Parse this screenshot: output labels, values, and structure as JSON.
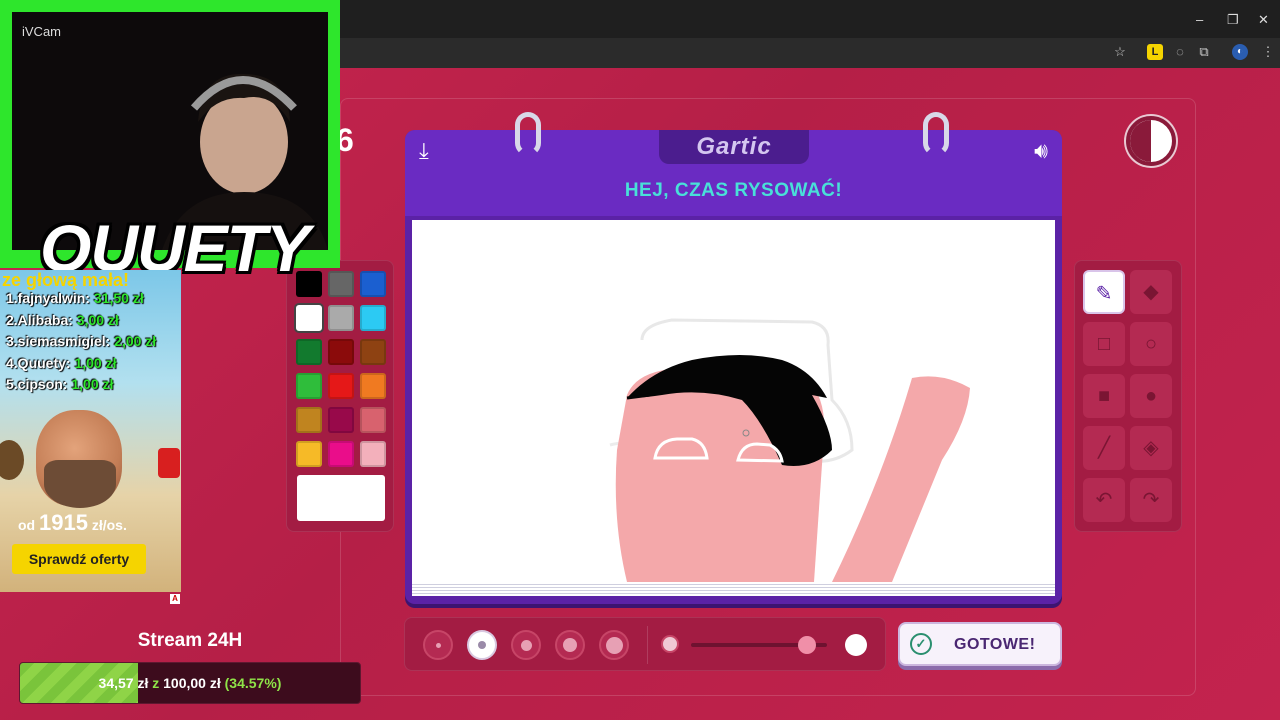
{
  "window": {
    "minimize": "–",
    "maximize": "❐",
    "close": "✕"
  },
  "game": {
    "round_digit": "6",
    "logo": "Gartic",
    "message": "HEJ, CZAS RYSOWAĆ!",
    "done_label": "GOTOWE!",
    "timer_progress": 0.5
  },
  "palette": {
    "colors": [
      "#000000",
      "#666666",
      "#1b5fd0",
      "#ffffff",
      "#aaaaaa",
      "#2ccaf3",
      "#127a2e",
      "#8b0b0b",
      "#8e4212",
      "#2fbd3b",
      "#e51818",
      "#f07a21",
      "#c0841f",
      "#98094a",
      "#d8626e",
      "#f6ba27",
      "#ea0d8a",
      "#f3b0bb"
    ],
    "selected_index": 3,
    "current_color": "#ffffff"
  },
  "tools": [
    {
      "name": "pencil",
      "icon": "✎",
      "active": true
    },
    {
      "name": "eraser",
      "icon": "◆",
      "active": false
    },
    {
      "name": "rectangle-outline",
      "icon": "□",
      "active": false
    },
    {
      "name": "ellipse-outline",
      "icon": "○",
      "active": false
    },
    {
      "name": "rectangle-filled",
      "icon": "■",
      "active": false
    },
    {
      "name": "ellipse-filled",
      "icon": "●",
      "active": false
    },
    {
      "name": "line",
      "icon": "╱",
      "active": false
    },
    {
      "name": "fill-bucket",
      "icon": "◈",
      "active": false
    },
    {
      "name": "undo",
      "icon": "↶",
      "active": false
    },
    {
      "name": "redo",
      "icon": "↷",
      "active": false
    }
  ],
  "brush": {
    "sizes": [
      1,
      2,
      3,
      4,
      5
    ],
    "selected_size_index": 1,
    "opacity_level": 0.85
  },
  "webcam": {
    "source_label": "iVCam",
    "overlay_name": "QUUETY"
  },
  "ad": {
    "tagline": "ze głową mała!",
    "donors": [
      {
        "rank": "1.",
        "name": "fajnyalwin:",
        "amount": "31,50 zł"
      },
      {
        "rank": "2.",
        "name": "Alibaba:",
        "amount": "3,00 zł"
      },
      {
        "rank": "3.",
        "name": "siemasmigiel:",
        "amount": "2,00 zł"
      },
      {
        "rank": "4.",
        "name": "Quuety:",
        "amount": "1,00 zł"
      },
      {
        "rank": "5.",
        "name": "cipson:",
        "amount": "1,00 zł"
      }
    ],
    "price_prefix": "od",
    "price_value": "1915",
    "price_suffix": "zł/os.",
    "button_label": "Sprawdź oferty",
    "badge": "A"
  },
  "goal": {
    "title": "Stream 24H",
    "current": "34,57 zł",
    "separator": "z",
    "target": "100,00 zł",
    "percent_text": "(34.57%)",
    "progress": 0.3457
  }
}
